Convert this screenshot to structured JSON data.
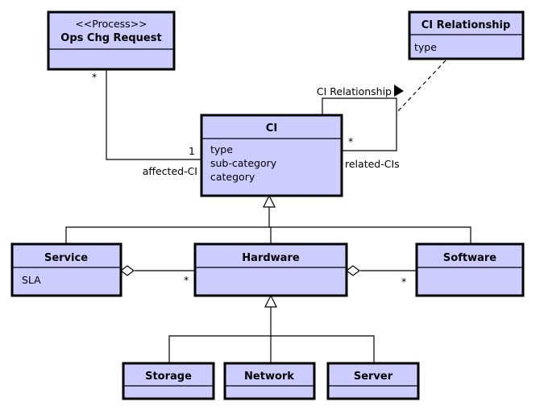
{
  "colors": {
    "class_fill": "#ccccff",
    "stroke": "#000000"
  },
  "classes": {
    "ops": {
      "stereotype": "<<Process>>",
      "name": "Ops Chg Request"
    },
    "ci_relationship": {
      "name": "CI Relationship",
      "attrs": [
        "type"
      ]
    },
    "ci": {
      "name": "CI",
      "attrs": [
        "type",
        "sub-category",
        "category"
      ]
    },
    "service": {
      "name": "Service",
      "attrs": [
        "SLA"
      ]
    },
    "hardware": {
      "name": "Hardware"
    },
    "software": {
      "name": "Software"
    },
    "storage": {
      "name": "Storage"
    },
    "network": {
      "name": "Network"
    },
    "server": {
      "name": "Server"
    }
  },
  "associations": {
    "ops_ci": {
      "ops_mult": "*",
      "ci_mult": "1",
      "ci_role": "affected-CI"
    },
    "ci_self": {
      "name": "CI Relationship",
      "mult": "*",
      "role": "related-CIs"
    },
    "service_hw": {
      "mult": "*"
    },
    "hw_sw": {
      "mult": "*"
    }
  }
}
